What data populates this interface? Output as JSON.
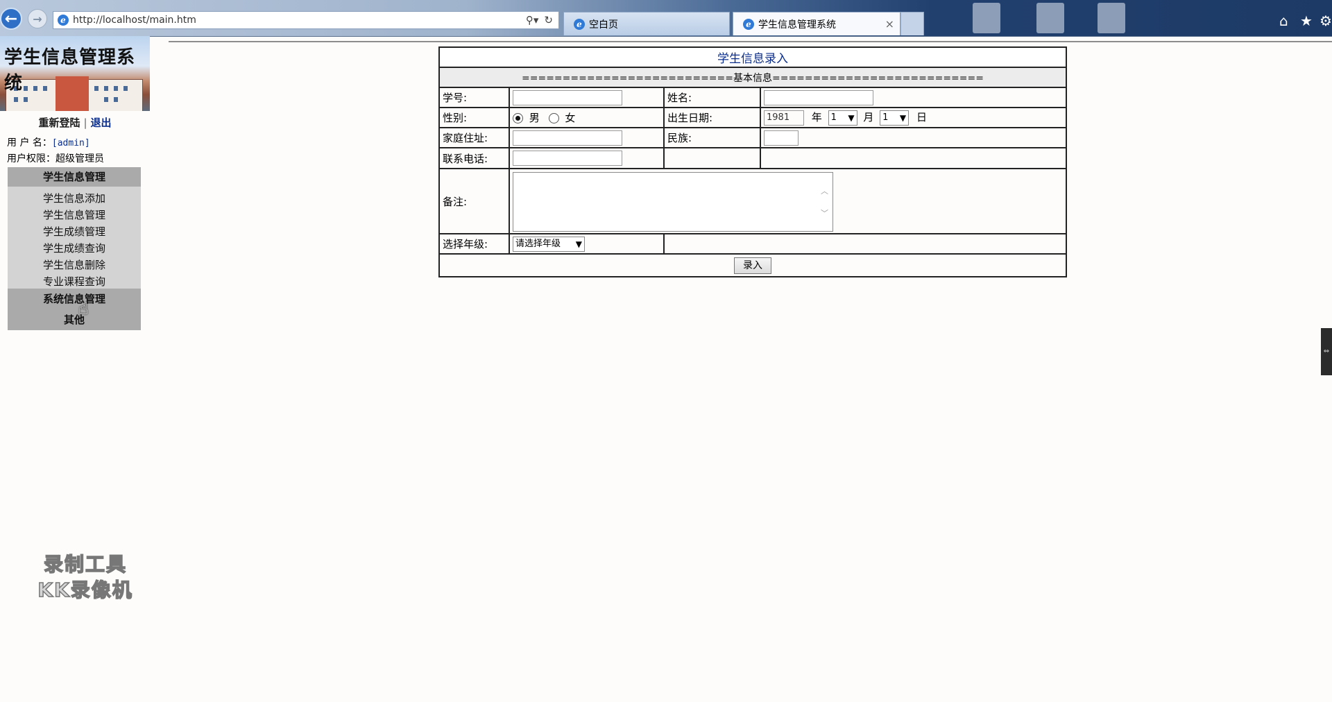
{
  "browser": {
    "url": "http://localhost/main.htm",
    "tabs": [
      {
        "label": "空白页",
        "active": false
      },
      {
        "label": "学生信息管理系统",
        "active": true
      }
    ],
    "tab_close_glyph": "×"
  },
  "sidebar": {
    "banner_title": "学生信息管理系统",
    "relogin_label": "重新登陆",
    "logout_label": "退出",
    "user_name_label": "用 户 名：",
    "user_name_value": "[admin]",
    "user_role_label": "用户权限：",
    "user_role_value": "超级管理员",
    "menu_header": "学生信息管理",
    "menu_items": [
      {
        "label": "学生信息添加"
      },
      {
        "label": "学生信息管理"
      },
      {
        "label": "学生成绩管理"
      },
      {
        "label": "学生成绩查询"
      },
      {
        "label": "学生信息删除"
      },
      {
        "label": "专业课程查询"
      }
    ],
    "system_menu": [
      {
        "label": "系统信息管理"
      },
      {
        "label": "其他"
      }
    ]
  },
  "form": {
    "title": "学生信息录入",
    "section": "==========================基本信息==========================",
    "student_id_label": "学号:",
    "name_label": "姓名:",
    "gender_label": "性别:",
    "gender_options": [
      {
        "label": "男",
        "checked": true
      },
      {
        "label": "女",
        "checked": false
      }
    ],
    "birth_label": "出生日期:",
    "birth_year_value": "1981",
    "year_unit": "年",
    "month_value": "1",
    "month_unit": "月",
    "day_value": "1",
    "day_unit": "日",
    "address_label": "家庭住址:",
    "ethnicity_label": "民族:",
    "phone_label": "联系电话:",
    "remark_label": "备注:",
    "grade_label": "选择年级:",
    "grade_selected": "请选择年级",
    "submit_label": "录入"
  },
  "watermark": {
    "line1": "录制工具",
    "line2": "KK录像机"
  },
  "colors": {
    "link_blue": "#0b2e8c",
    "menu_bg": "#d3d3d3",
    "menu_head_bg": "#aaaaaa"
  }
}
